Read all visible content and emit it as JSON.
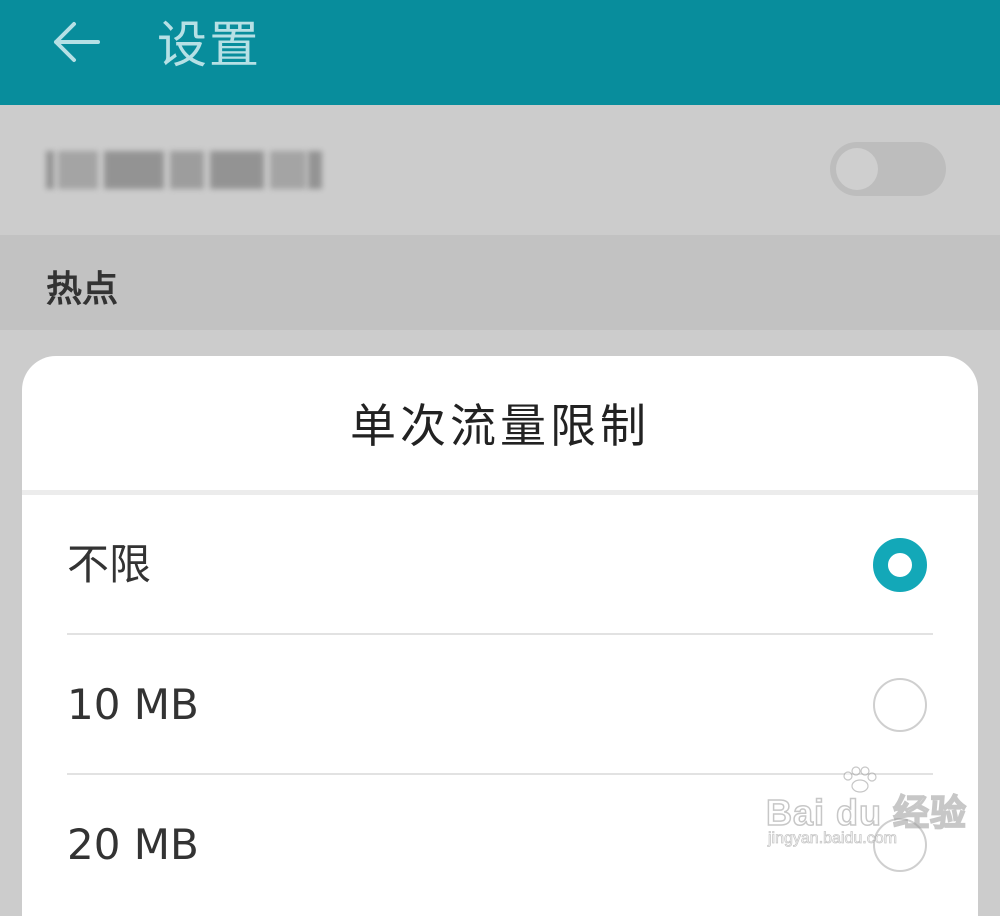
{
  "header": {
    "back_icon": "arrow-left-icon",
    "title": "设置"
  },
  "hotspot_row": {
    "toggle_on": false
  },
  "section": {
    "title": "热点"
  },
  "dialog": {
    "title": "单次流量限制",
    "options": [
      {
        "label": "不限",
        "selected": true
      },
      {
        "label": "10 MB",
        "selected": false
      },
      {
        "label": "20 MB",
        "selected": false
      }
    ]
  },
  "watermark": {
    "text": "Bai du 经验",
    "subtext": "jingyan.baidu.com"
  },
  "colors": {
    "accent": "#088d9c",
    "radio_active": "#13a8b8"
  }
}
